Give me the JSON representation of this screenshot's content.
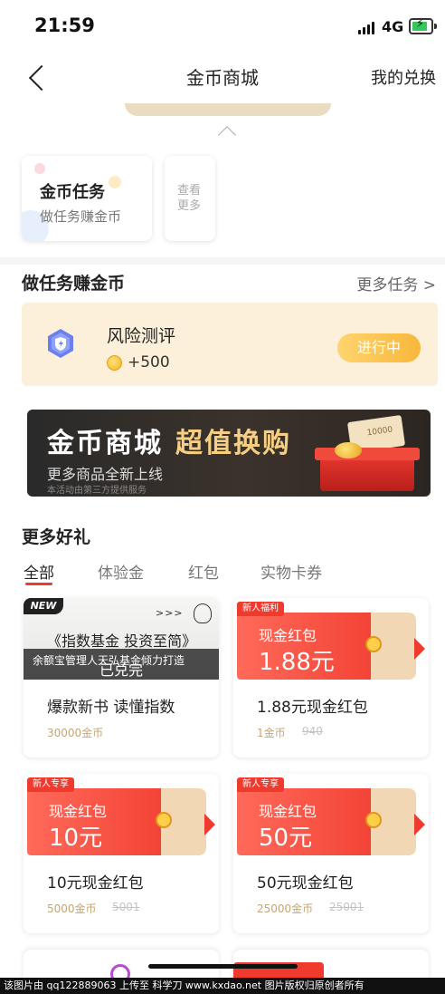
{
  "status_bar": {
    "time": "21:59",
    "network": "4G"
  },
  "nav": {
    "title": "金币商城",
    "right": "我的兑换"
  },
  "top_cards": {
    "task_card": {
      "title": "金币任务",
      "subtitle": "做任务赚金币"
    },
    "see_more": "查看更多"
  },
  "earn_section": {
    "title": "做任务赚金币",
    "more": "更多任务 >",
    "task": {
      "name": "风险测评",
      "reward": "+500",
      "status": "进行中"
    }
  },
  "promo_banner": {
    "title_1": "金币商城",
    "title_2": "超值换购",
    "subtitle": "更多商品全新上线",
    "note": "本活动由第三方提供服务",
    "ticket_text": "10000"
  },
  "gifts_section": {
    "title": "更多好礼",
    "tabs": [
      "全部",
      "体验金",
      "红包",
      "实物卡券"
    ],
    "active_tab": "全部"
  },
  "products": [
    {
      "tag": "NEW",
      "image_title": "《指数基金 投资至简》",
      "image_sub": "余额宝管理人天弘基金倾力打造",
      "overlay": "已兑完",
      "name": "爆款新书 读懂指数",
      "price": "30000金币",
      "original": ""
    },
    {
      "tag": "新人福利",
      "env_label": "现金红包",
      "env_amount": "1.88元",
      "name": "1.88元现金红包",
      "price": "1金币",
      "original": "940"
    },
    {
      "tag": "新人专享",
      "env_label": "现金红包",
      "env_amount": "10元",
      "name": "10元现金红包",
      "price": "5000金币",
      "original": "5001"
    },
    {
      "tag": "新人专享",
      "env_label": "现金红包",
      "env_amount": "50元",
      "name": "50元现金红包",
      "price": "25000金币",
      "original": "25001"
    }
  ],
  "watermark": "该图片由 qq122889063 上传至 科学刀 www.kxdao.net 图片版权归原创者所有",
  "colors": {
    "accent_red": "#e83d33",
    "gold": "#f8b73a",
    "task_bg": "#fdf0da"
  }
}
